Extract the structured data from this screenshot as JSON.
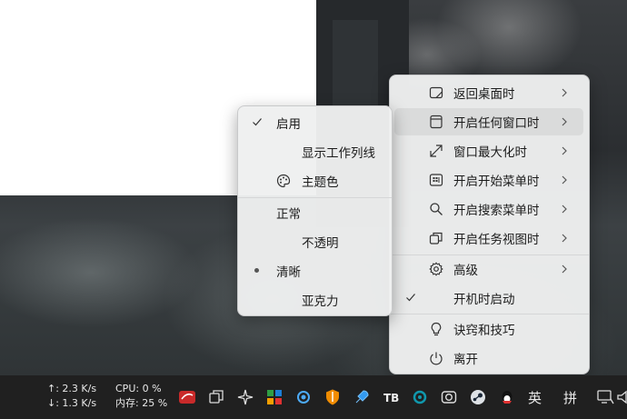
{
  "main_menu": {
    "items": [
      {
        "label": "返回桌面时",
        "icon": "desktop-icon",
        "submenu": true
      },
      {
        "label": "开启任何窗口时",
        "icon": "window-icon",
        "submenu": true
      },
      {
        "label": "窗口最大化时",
        "icon": "maximize-icon",
        "submenu": true
      },
      {
        "label": "开启开始菜单时",
        "icon": "start-menu-icon",
        "submenu": true
      },
      {
        "label": "开启搜索菜单时",
        "icon": "search-icon",
        "submenu": true
      },
      {
        "label": "开启任务视图时",
        "icon": "task-view-icon",
        "submenu": true
      },
      {
        "label": "高级",
        "icon": "gear-icon",
        "submenu": true
      },
      {
        "label": "开机时启动",
        "icon": "check-icon",
        "checked": true
      },
      {
        "label": "诀窍和技巧",
        "icon": "lightbulb-icon"
      },
      {
        "label": "离开",
        "icon": "power-icon"
      }
    ]
  },
  "sub_menu": {
    "items": [
      {
        "label": "启用",
        "checked": true
      },
      {
        "label": "显示工作列线"
      },
      {
        "label": "主题色",
        "icon": "palette-icon"
      },
      {
        "label": "正常"
      },
      {
        "label": "不透明"
      },
      {
        "label": "清晰",
        "selected": true
      },
      {
        "label": "亚克力"
      }
    ]
  },
  "taskbar": {
    "upload": "↑: 2.3 K/s",
    "download": "↓: 1.3 K/s",
    "cpu": "CPU: 0 %",
    "memory": "内存: 25 %",
    "ime_lang": "英",
    "ime_mode": "拼"
  },
  "colors": {
    "taskbar": "#202020",
    "menu": "#eeeff0",
    "accent": "#0a5fd6"
  }
}
